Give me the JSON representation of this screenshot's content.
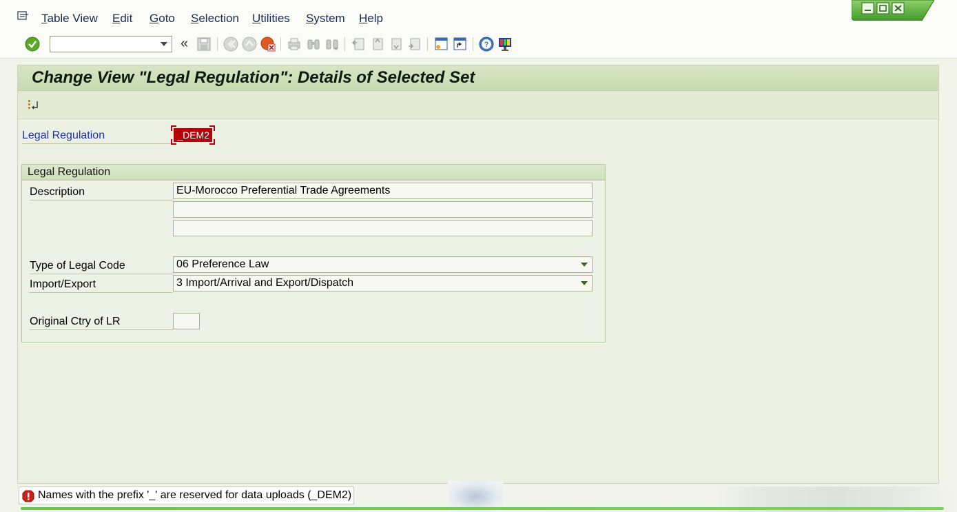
{
  "menu": {
    "items": [
      {
        "label": "Table View",
        "ul": "T",
        "rest": "able View"
      },
      {
        "label": "Edit",
        "ul": "E",
        "rest": "dit"
      },
      {
        "label": "Goto",
        "ul": "G",
        "rest": "oto"
      },
      {
        "label": "Selection",
        "ul": "S",
        "rest": "election"
      },
      {
        "label": "Utilities",
        "ul": "U",
        "rest": "tilities"
      },
      {
        "label": "System",
        "ul": "S",
        "rest": "ystem"
      },
      {
        "label": "Help",
        "ul": "H",
        "rest": "elp"
      }
    ]
  },
  "toolbar": {
    "command_field_value": "",
    "back_glyph": "«"
  },
  "screen": {
    "title": "Change View \"Legal Regulation\": Details of Selected Set"
  },
  "key": {
    "label": "Legal Regulation",
    "value": "_DEM2"
  },
  "group": {
    "title": "Legal Regulation",
    "description_label": "Description",
    "description_line1": "EU-Morocco Preferential Trade Agreements",
    "description_line2": "",
    "description_line3": "",
    "type_label": "Type of Legal Code",
    "type_value": "06 Preference Law",
    "impexp_label": "Import/Export",
    "impexp_value": "3 Import/Arrival and Export/Dispatch",
    "ctry_label": "Original Ctry of LR",
    "ctry_value": ""
  },
  "status": {
    "type": "error",
    "message": "Names with the prefix '_' are reserved for data uploads (_DEM2)"
  },
  "colors": {
    "title_bg": "#c8dbb0",
    "key_field_error": "#b5000c",
    "label_blue": "#1e2fb0",
    "accent_green": "#6cc54a"
  }
}
